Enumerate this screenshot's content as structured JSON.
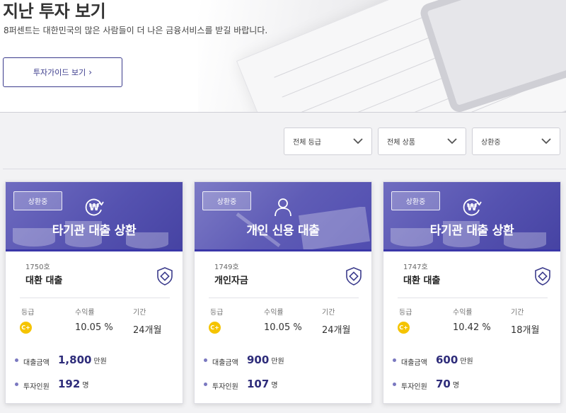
{
  "hero": {
    "title": "지난 투자 보기",
    "subtitle": "8퍼센트는 대한민국의 많은 사람들이 더 나은 금융서비스를 받길 바랍니다.",
    "guide_button": "투자가이드 보기"
  },
  "filters": [
    {
      "label": "전체 등급"
    },
    {
      "label": "전체 상품"
    },
    {
      "label": "상환중"
    }
  ],
  "labels": {
    "grade": "등급",
    "rate": "수익률",
    "period": "기간",
    "loan_amount": "대출금액",
    "investors": "투자인원",
    "manwon": "만원",
    "people": "명"
  },
  "cards": [
    {
      "status": "상환중",
      "category": "타기관 대출 상환",
      "icon": "won-refresh-icon",
      "number": "1750호",
      "name": "대환 대출",
      "grade": "C+",
      "rate": "10.05 %",
      "period": "24개월",
      "amount": "1,800",
      "investors": "192"
    },
    {
      "status": "상환중",
      "category": "개인 신용 대출",
      "icon": "person-icon",
      "number": "1749호",
      "name": "개인자금",
      "grade": "C+",
      "rate": "10.05 %",
      "period": "24개월",
      "amount": "900",
      "investors": "107"
    },
    {
      "status": "상환중",
      "category": "타기관 대출 상환",
      "icon": "won-refresh-icon",
      "number": "1747호",
      "name": "대환 대출",
      "grade": "C+",
      "rate": "10.42 %",
      "period": "18개월",
      "amount": "600",
      "investors": "70"
    }
  ],
  "colors": {
    "accent": "#3b3b8c",
    "card_header": "#5552b0",
    "grade": "#f5c400"
  }
}
